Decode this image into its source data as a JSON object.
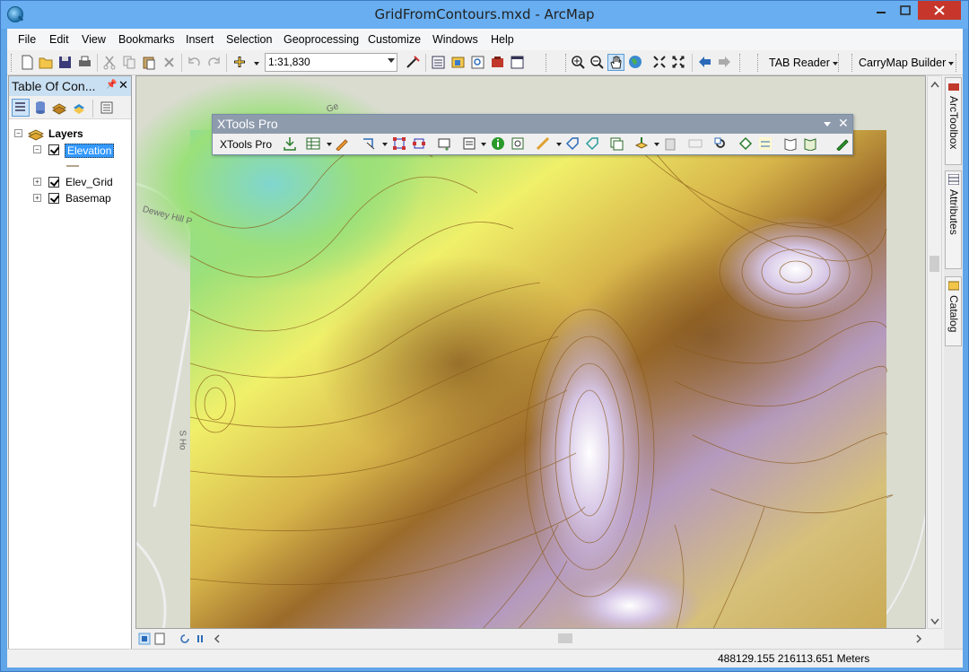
{
  "window": {
    "title": "GridFromContours.mxd - ArcMap"
  },
  "menubar": {
    "items": [
      "File",
      "Edit",
      "View",
      "Bookmarks",
      "Insert",
      "Selection",
      "Geoprocessing",
      "Customize",
      "Windows",
      "Help"
    ]
  },
  "toolbar": {
    "scale": "1:31,830",
    "tab_reader": "TAB Reader",
    "carrymap_builder": "CarryMap Builder"
  },
  "toc": {
    "title": "Table Of Con...",
    "root": "Layers",
    "layers": [
      {
        "name": "Elevation",
        "checked": true,
        "expanded": true,
        "selected": true
      },
      {
        "name": "Elev_Grid",
        "checked": true,
        "expanded": false
      },
      {
        "name": "Basemap",
        "checked": true,
        "expanded": false
      }
    ]
  },
  "xtools": {
    "title": "XTools Pro",
    "label": "XTools Pro"
  },
  "basemap_labels": [
    "Dewey Hill P",
    "S Ho",
    "Ge"
  ],
  "right_dock": {
    "tabs": [
      "ArcToolbox",
      "Attributes",
      "Catalog"
    ]
  },
  "statusbar": {
    "coordinates": "488129.155  216113.651 Meters"
  },
  "colors": {
    "titlebar": "#68aef0",
    "selection": "#3399ff",
    "close_button": "#c7362a",
    "xtools_title": "#8e9bad"
  }
}
